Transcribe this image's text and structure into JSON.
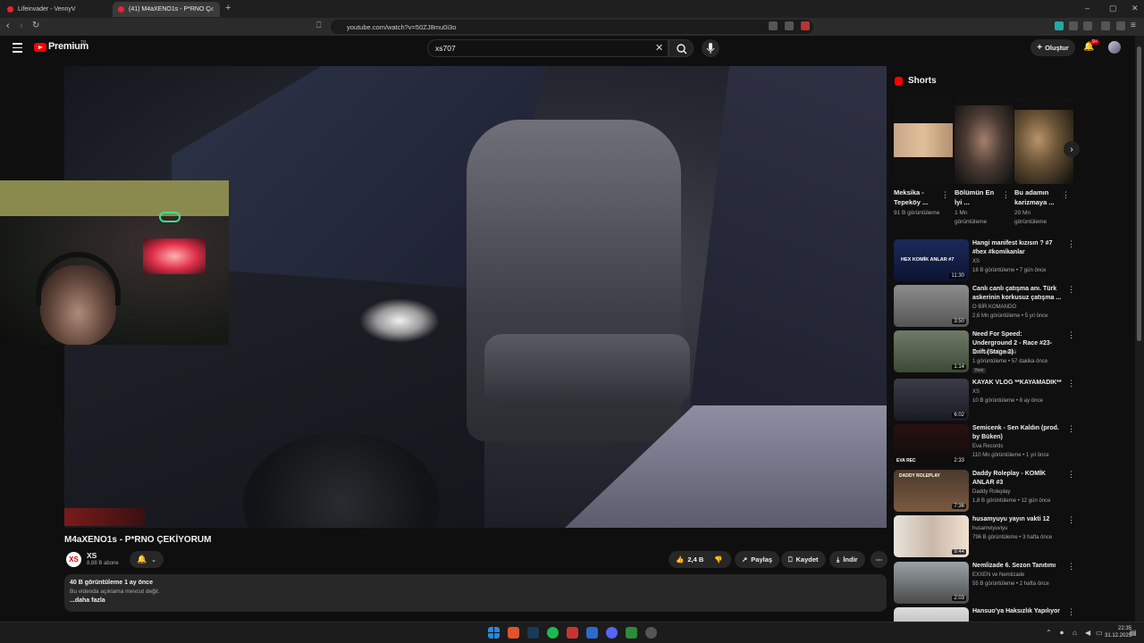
{
  "browser": {
    "tabs": [
      {
        "title": "Lifeinvader - VennyV"
      },
      {
        "title": "(41) M4aXENO1s - P*RNO Ç"
      }
    ],
    "new_tab": "+",
    "url": "youtube.com/watch?v=50ZJ8mu0i3o"
  },
  "header": {
    "brand": "Premium",
    "brand_tr": "TR",
    "search_value": "xs707",
    "create_label": "Oluştur",
    "notif_count": "9+"
  },
  "video": {
    "title": "M4aXENO1s - P*RNO ÇEKİYORUM",
    "channel_logo": "XS",
    "channel_name": "XS",
    "subscribers": "8,88 B abone",
    "likes": "2,4 B",
    "share": "Paylaş",
    "save": "Kaydet",
    "download": "İndir",
    "desc_stats": "40 B görüntüleme  1 ay önce",
    "desc_text": "Bu videoda açıklama mevcut değil.",
    "desc_more": "...daha fazla"
  },
  "shorts": {
    "heading": "Shorts",
    "items": [
      {
        "title": "Meksika - Tepeköy ...",
        "views": "91 B görüntüleme"
      },
      {
        "title": "Bölümün En İyi ...",
        "views": "1 Mn görüntüleme"
      },
      {
        "title": "Bu adamın karizmaya ...",
        "views": "20 Mn görüntüleme"
      }
    ]
  },
  "recommendations": [
    {
      "title": "Hangi manifest kızısın ? #7 #hex #komikanlar",
      "channel": "XS",
      "meta": "18 B görüntüleme • 7 gün önce",
      "duration": "11:30",
      "thumb_text": "HEX KOMİK ANLAR #7"
    },
    {
      "title": "Canlı canlı çatışma anı. Türk askerinin korkusuz çatışma ...",
      "channel": "O BİR KOMANDO",
      "meta": "2,6 Mn görüntüleme • 5 yıl önce",
      "duration": "3:50"
    },
    {
      "title": "Need For Speed: Underground 2 - Race #23- Drift (Stage 2)",
      "channel": "mert artun01 ailesi",
      "meta": "1 görüntüleme • 57 dakika önce",
      "duration": "1:14",
      "badge": "Yeni"
    },
    {
      "title": "KAYAK VLOG **KAYAMADIK**",
      "channel": "XS",
      "meta": "10 B görüntüleme • 8 ay önce",
      "duration": "6:02"
    },
    {
      "title": "Semicenk - Sen Kaldın (prod. by Büken)",
      "channel": "Eva Records",
      "meta": "110 Mn görüntüleme • 1 yıl önce",
      "duration": "2:33",
      "thumb_text": "EVA REC"
    },
    {
      "title": "Daddy Roleplay - KOMİK ANLAR #3",
      "channel": "Daddy Roleplay",
      "meta": "1,8 B görüntüleme • 12 gün önce",
      "duration": "7:36",
      "thumb_text": "DADDY ROLEPLAY"
    },
    {
      "title": "husamyuyu yayın vakti 12",
      "channel": "husamviyuviyu",
      "meta": "796 B görüntüleme • 3 hafta önce",
      "duration": "9:44"
    },
    {
      "title": "Nemlizade 6. Sezon Tanıtımı",
      "channel": "EXXEN ve Nemlizade",
      "meta": "55 B görüntüleme • 2 hafta önce",
      "duration": "2:03"
    },
    {
      "title": "Hansuo'ya Haksızlık Yapılıyor",
      "channel": "",
      "meta": "",
      "duration": ""
    }
  ],
  "taskbar": {
    "time": "22:35",
    "date": "31.12.2025"
  },
  "colors": {
    "accent": "#ff0000",
    "background": "#0f0f0f",
    "surface": "#272727"
  }
}
